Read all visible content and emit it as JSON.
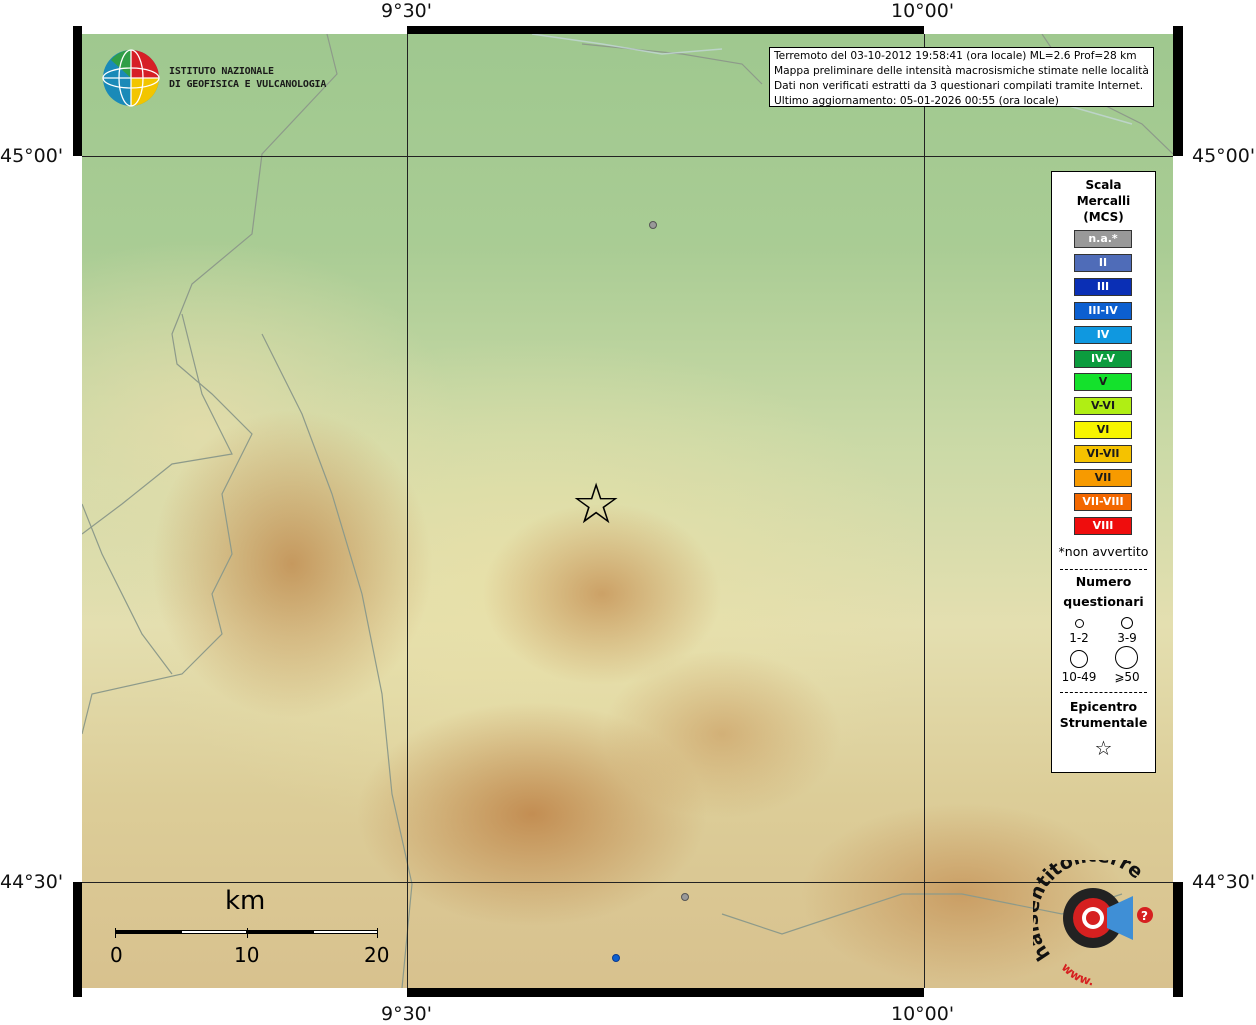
{
  "coords": {
    "top_left_lon": "9°30'",
    "top_right_lon": "10°00'",
    "bottom_left_lon": "9°30'",
    "bottom_right_lon": "10°00'",
    "left_upper_lat": "45°00'",
    "left_lower_lat": "44°30'",
    "right_upper_lat": "45°00'",
    "right_lower_lat": "44°30'"
  },
  "logo": {
    "line1": "ISTITUTO NAZIONALE",
    "line2": "DI GEOFISICA E VULCANOLOGIA"
  },
  "info": {
    "line1": "Terremoto del 03-10-2012 19:58:41 (ora locale) ML=2.6 Prof=28 km",
    "line2": "Mappa preliminare delle intensità macrosismiche stimate nelle località",
    "line3": "Dati non verificati estratti da 3 questionari compilati tramite Internet.",
    "line4": "Ultimo aggiornamento: 05-01-2026 00:55 (ora locale)"
  },
  "legend": {
    "title1": "Scala",
    "title2": "Mercalli",
    "title3": "(MCS)",
    "items": [
      {
        "label": "n.a.*",
        "color": "#999999"
      },
      {
        "label": "II",
        "color": "#4f6cb8"
      },
      {
        "label": "III",
        "color": "#0a2fb5"
      },
      {
        "label": "III-IV",
        "color": "#0c5fd0"
      },
      {
        "label": "IV",
        "color": "#0f98e0"
      },
      {
        "label": "IV-V",
        "color": "#0c9c3e"
      },
      {
        "label": "V",
        "color": "#14e12c"
      },
      {
        "label": "V-VI",
        "color": "#b0ee14"
      },
      {
        "label": "VI",
        "color": "#f7f400"
      },
      {
        "label": "VI-VII",
        "color": "#f5c200"
      },
      {
        "label": "VII",
        "color": "#f79a00"
      },
      {
        "label": "VII-VIII",
        "color": "#f36800"
      },
      {
        "label": "VIII",
        "color": "#ef0d0d"
      }
    ],
    "note": "*non avvertito",
    "q_title1": "Numero",
    "q_title2": "questionari",
    "q_labels": [
      "1-2",
      "3-9",
      "10-49",
      "⩾50"
    ],
    "epi_title1": "Epicentro",
    "epi_title2": "Strumentale",
    "epi_symbol": "☆"
  },
  "scalebar": {
    "unit": "km",
    "labels": [
      "0",
      "10",
      "20"
    ]
  },
  "epicenter_symbol": "☆",
  "hs_logo": {
    "text": "haisentitoilterremoto.it",
    "url": "www.",
    "question": "?"
  }
}
